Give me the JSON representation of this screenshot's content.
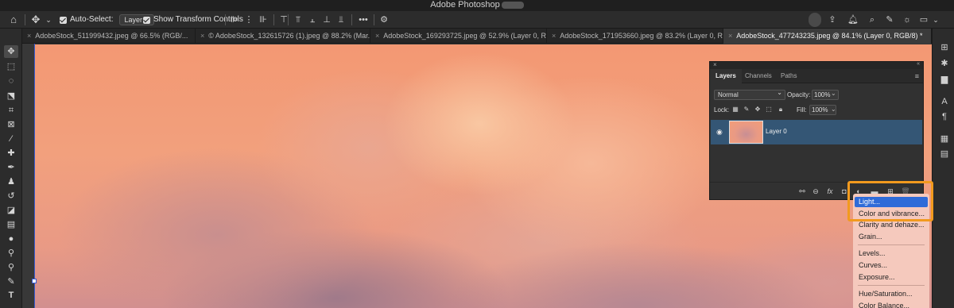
{
  "window": {
    "title": "Adobe Photoshop"
  },
  "options_bar": {
    "auto_select_label": "Auto-Select:",
    "auto_select_value": "Layer",
    "transform_controls_label": "Show Transform Controls",
    "more_label": "•••"
  },
  "tabs": [
    {
      "label": "AdobeStock_511999432.jpeg @ 66.5% (RGB/...",
      "close": "×"
    },
    {
      "label": "© AdobeStock_132615726 (1).jpeg @ 88.2% (Mar...",
      "close": "×"
    },
    {
      "label": "AdobeStock_169293725.jpeg @ 52.9% (Layer 0, R...",
      "close": "×"
    },
    {
      "label": "AdobeStock_171953660.jpeg @ 83.2% (Layer 0, R...",
      "close": "×"
    },
    {
      "label": "AdobeStock_477243235.jpeg @ 84.1% (Layer 0, RGB/8) *",
      "close": "×"
    }
  ],
  "layers_panel": {
    "tabs": [
      "Layers",
      "Channels",
      "Paths"
    ],
    "blend_mode": "Normal",
    "opacity_label": "Opacity:",
    "opacity_value": "100%",
    "lock_label": "Lock:",
    "fill_label": "Fill:",
    "fill_value": "100%",
    "layers": [
      {
        "name": "Layer 0"
      }
    ],
    "footer_fx": "fx"
  },
  "adjustment_menu": {
    "items": [
      {
        "label": "Light...",
        "selected": true
      },
      {
        "label": "Color and vibrance..."
      },
      {
        "label": "Clarity and dehaze..."
      },
      {
        "label": "Grain..."
      },
      {
        "label": "Levels..."
      },
      {
        "label": "Curves..."
      },
      {
        "label": "Exposure..."
      },
      {
        "label": "Hue/Saturation..."
      },
      {
        "label": "Color Balance..."
      }
    ]
  },
  "colors": {
    "accent_highlight": "#f29a1e",
    "selected_layer": "#345675",
    "menu_selected": "#2f6bd8"
  }
}
